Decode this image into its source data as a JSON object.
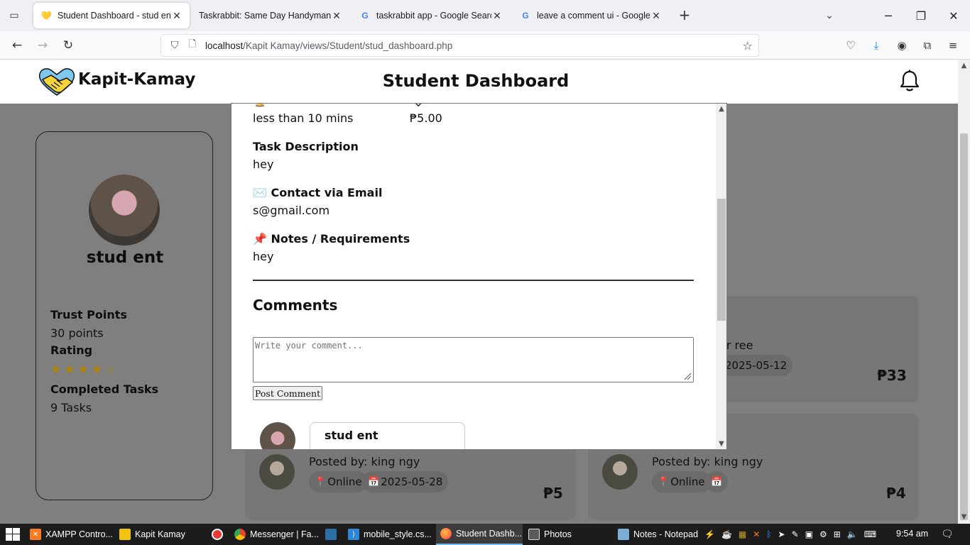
{
  "browser": {
    "tabs": [
      {
        "title": "Student Dashboard - stud ent",
        "active": true
      },
      {
        "title": "Taskrabbit: Same Day Handyman, M",
        "active": false
      },
      {
        "title": "taskrabbit app - Google Search",
        "active": false
      },
      {
        "title": "leave a comment ui - Google Se",
        "active": false
      }
    ],
    "url_host": "localhost",
    "url_path": "/Kapit Kamay/views/Student/stud_dashboard.php"
  },
  "header": {
    "brand": "Kapit-Kamay",
    "title": "Student Dashboard"
  },
  "profile": {
    "name": "stud ent",
    "trust_label": "Trust Points",
    "trust_value": "30 points",
    "rating_label": "Rating",
    "rating_stars": "★★★★☆",
    "completed_label": "Completed Tasks",
    "completed_value": "9 Tasks"
  },
  "task_cards": [
    {
      "posted_by": "er ree",
      "date": "2025-05-12",
      "price": "₱33"
    },
    {
      "posted_by": "Posted by: king ngy",
      "location": "Online",
      "date": "2025-05-28",
      "price": "₱5"
    },
    {
      "posted_by": "Posted by: king ngy",
      "location": "Online",
      "price": "₱4"
    }
  ],
  "modal": {
    "estimated_duration_value": "less than 10 mins",
    "price_value": "₱5.00",
    "task_description_label": "Task Description",
    "task_description_value": "hey",
    "contact_label": "Contact via Email",
    "contact_value": "s@gmail.com",
    "notes_label": "Notes / Requirements",
    "notes_value": "hey",
    "comments_heading": "Comments",
    "comment_placeholder": "Write your comment...",
    "post_button": "Post Comment",
    "comments": [
      {
        "author": "stud ent"
      }
    ]
  },
  "taskbar": {
    "items": [
      {
        "label": "XAMPP Contro...",
        "color": "#fb7a24"
      },
      {
        "label": "Kapit Kamay",
        "color": "#f1c40f"
      },
      {
        "label": "",
        "color": "#e53935"
      },
      {
        "label": "Messenger | Fa...",
        "color": "#34a853"
      },
      {
        "label": "",
        "color": "#2c6ea6"
      },
      {
        "label": "mobile_style.cs...",
        "color": "#2f86d6"
      },
      {
        "label": "Student Dashb...",
        "color": "#ff7139"
      },
      {
        "label": "Photos",
        "color": "#5a5a5a"
      },
      {
        "label": "Notes - Notepad",
        "color": "#7ab0d6"
      }
    ],
    "clock": "9:54 am"
  },
  "colors": {
    "overlay": "#7f7f7f",
    "accent_blue": "#76b9ed",
    "star": "#b38400"
  }
}
